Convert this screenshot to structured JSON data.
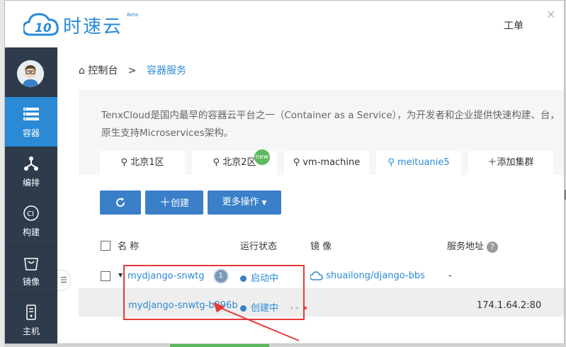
{
  "header": {
    "logo_text": "时速云",
    "beta": "Beta",
    "ticket": "工单"
  },
  "sidebar": {
    "items": [
      {
        "label": "容器",
        "icon": "container-icon",
        "active": true
      },
      {
        "label": "编排",
        "icon": "orchestration-icon",
        "active": false
      },
      {
        "label": "构建",
        "icon": "ci-icon",
        "active": false
      },
      {
        "label": "镜像",
        "icon": "image-icon",
        "active": false
      },
      {
        "label": "主机",
        "icon": "host-icon",
        "active": false
      }
    ]
  },
  "breadcrumb": {
    "home": "控制台",
    "separator": ">",
    "current": "容器服务"
  },
  "description": "TenxCloud是国内最早的容器云平台之一（Container as a Service），为开发者和企业提供快速构建、台，原生支持Microservices架构。",
  "tabs": [
    {
      "label": "北京1区",
      "active": false
    },
    {
      "label": "北京2区",
      "active": false,
      "badge": "new"
    },
    {
      "label": "vm-machine",
      "active": false
    },
    {
      "label": "meituanie5",
      "active": true
    },
    {
      "label": "添加集群",
      "active": false
    }
  ],
  "toolbar": {
    "refresh_icon": "refresh-icon",
    "create_label": "创建",
    "more_label": "更多操作"
  },
  "table": {
    "headers": {
      "name": "名 称",
      "status": "运行状态",
      "image": "镜 像",
      "address": "服务地址"
    },
    "rows": [
      {
        "name": "mydjango-snwtg",
        "count": "1",
        "status": "启动中",
        "image": "shuailong/django-bbs",
        "address": "-"
      },
      {
        "name": "mydjango-snwtg-b896b",
        "status": "创建中",
        "address": "174.1.64.2:80"
      }
    ]
  },
  "colors": {
    "accent": "#2b8ad6",
    "sidebar": "#2e3b4a",
    "annotation": "#e53a3a"
  }
}
